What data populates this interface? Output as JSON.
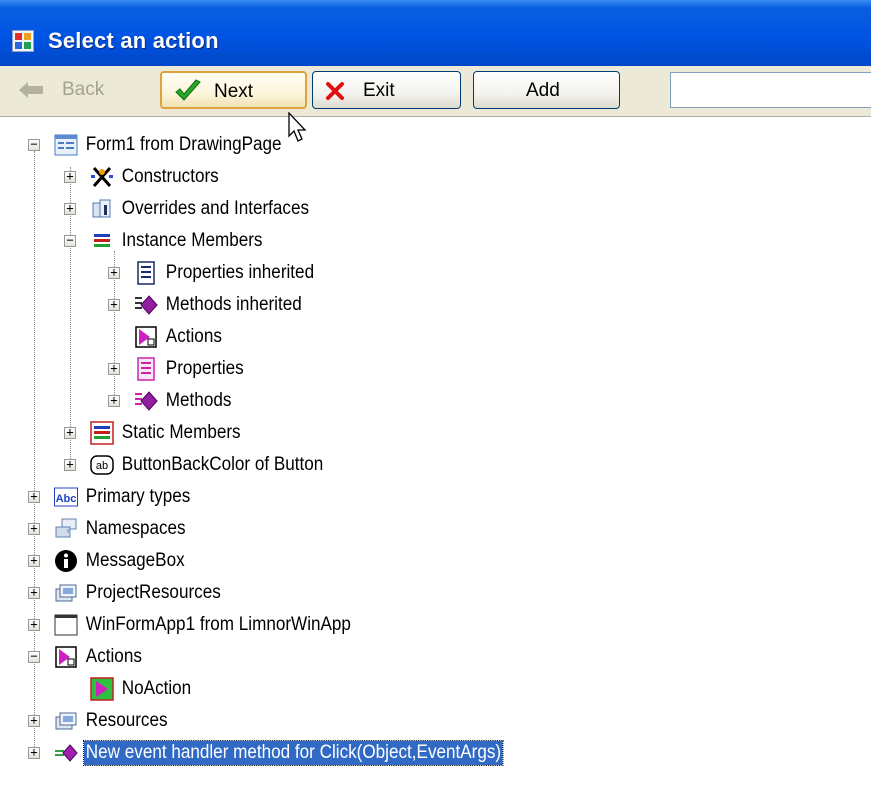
{
  "window": {
    "title": "Select an action"
  },
  "toolbar": {
    "back_label": "Back",
    "next_label": "Next",
    "exit_label": "Exit",
    "add_label": "Add",
    "search_value": ""
  },
  "tree": {
    "items": [
      {
        "label": "Form1 from DrawingPage",
        "expander": "−",
        "icon": "form-icon"
      },
      {
        "label": "Constructors",
        "expander": "+",
        "icon": "constructor-icon"
      },
      {
        "label": "Overrides and Interfaces",
        "expander": "+",
        "icon": "interface-icon"
      },
      {
        "label": "Instance Members",
        "expander": "−",
        "icon": "members-icon"
      },
      {
        "label": "Properties inherited",
        "expander": "+",
        "icon": "properties-icon"
      },
      {
        "label": "Methods inherited",
        "expander": "+",
        "icon": "method-icon"
      },
      {
        "label": "Actions",
        "expander": "",
        "icon": "action-icon"
      },
      {
        "label": "Properties",
        "expander": "+",
        "icon": "properties-pink-icon"
      },
      {
        "label": "Methods",
        "expander": "+",
        "icon": "method-icon"
      },
      {
        "label": "Static Members",
        "expander": "+",
        "icon": "static-members-icon"
      },
      {
        "label": "ButtonBackColor of Button",
        "expander": "+",
        "icon": "ab-icon"
      },
      {
        "label": "Primary types",
        "expander": "+",
        "icon": "abc-icon"
      },
      {
        "label": "Namespaces",
        "expander": "+",
        "icon": "namespace-icon"
      },
      {
        "label": "MessageBox",
        "expander": "+",
        "icon": "info-icon"
      },
      {
        "label": "ProjectResources",
        "expander": "+",
        "icon": "resources-icon"
      },
      {
        "label": "WinFormApp1 from LimnorWinApp",
        "expander": "+",
        "icon": "window-icon"
      },
      {
        "label": "Actions",
        "expander": "−",
        "icon": "action-icon"
      },
      {
        "label": "NoAction",
        "expander": "",
        "icon": "noaction-icon"
      },
      {
        "label": "Resources",
        "expander": "+",
        "icon": "resources-icon"
      },
      {
        "label": "New event handler method for Click(Object,EventArgs)",
        "expander": "+",
        "icon": "event-handler-icon"
      }
    ]
  },
  "colors": {
    "titlebar": "#0054e3",
    "selection": "#316ac5",
    "toolbar_bg": "#ece9d8"
  }
}
